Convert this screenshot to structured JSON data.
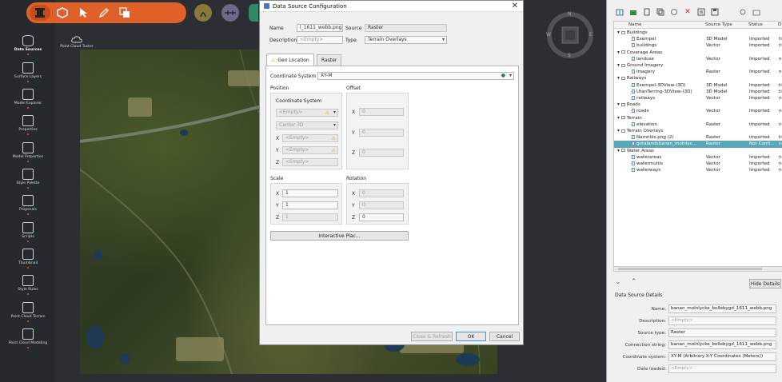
{
  "rail": [
    {
      "label": "Data Sources",
      "icon": "database-icon",
      "active": true
    },
    {
      "label": "Surface Layers",
      "icon": "layers-icon"
    },
    {
      "label": "Model Explorer",
      "icon": "model-explorer-icon"
    },
    {
      "label": "Properties",
      "icon": "properties-icon"
    },
    {
      "label": "Model Properties",
      "icon": "model-properties-icon"
    },
    {
      "label": "Style Palette",
      "icon": "style-palette-icon"
    },
    {
      "label": "Proposals",
      "icon": "proposals-icon"
    },
    {
      "label": "Scripts",
      "icon": "scripts-icon"
    },
    {
      "label": "Thumbnail",
      "icon": "thumbnail-icon"
    },
    {
      "label": "Style Rules",
      "icon": "style-rules-icon"
    },
    {
      "label": "Point Cloud Terrain",
      "icon": "point-cloud-terrain-icon"
    },
    {
      "label": "Point Cloud Modeling",
      "icon": "point-cloud-modeling-icon"
    }
  ],
  "map_uploader_label": "Point Cloud Tuster",
  "compass": {
    "n": "N",
    "s": "S",
    "e": "E",
    "w": "W"
  },
  "dialog": {
    "title": "Data Source Configuration",
    "name_label": "Name",
    "name_value": "l_1611_webb.png",
    "source_label": "Source",
    "source_value": "Raster",
    "description_label": "Description",
    "description_value": "<Empty>",
    "type_label": "Type",
    "type_value": "Terrain Overlays",
    "tabs": [
      "Geo Location",
      "Raster"
    ],
    "coord_system_label": "Coordinate System",
    "coord_system_value": "XY-M",
    "position_label": "Position",
    "offset_label": "Offset",
    "pos_coord_system_label": "Coordinate System",
    "pos_coord_value": "<Empty>",
    "pos_center_value": "Center 3D",
    "pos_x_value": "<Empty>",
    "pos_y_value": "<Empty>",
    "pos_z_value": "<Empty>",
    "offset_x": "0",
    "offset_y": "0",
    "offset_z": "0",
    "scale_label": "Scale",
    "scale_x": "1",
    "scale_y": "1",
    "scale_z": "1",
    "rotation_label": "Rotation",
    "rotation_x": "0",
    "rotation_y": "0",
    "rotation_z": "0",
    "x": "X",
    "y": "Y",
    "z": "Z",
    "interactive_button": "Interactive Plac...",
    "close_refresh": "Close & Refresh",
    "ok": "OK",
    "cancel": "Cancel"
  },
  "tree": {
    "columns": [
      "Name",
      "Source Type",
      "Status",
      "D"
    ],
    "rows": [
      {
        "indent": 0,
        "folder": true,
        "name": "Buildings",
        "type": "",
        "status": "",
        "d": ""
      },
      {
        "indent": 1,
        "name": "Exempel",
        "type": "3D Model",
        "status": "Imported",
        "d": "ti"
      },
      {
        "indent": 1,
        "name": "buildings",
        "type": "Vector",
        "status": "Imported",
        "d": "n"
      },
      {
        "indent": 0,
        "folder": true,
        "name": "Coverage Areas",
        "type": "",
        "status": "",
        "d": ""
      },
      {
        "indent": 1,
        "name": "landuse",
        "type": "Vector",
        "status": "Imported",
        "d": "n"
      },
      {
        "indent": 0,
        "folder": true,
        "name": "Ground Imagery",
        "type": "",
        "status": "",
        "d": ""
      },
      {
        "indent": 1,
        "name": "imagery",
        "type": "Raster",
        "status": "Imported",
        "d": "n"
      },
      {
        "indent": 0,
        "folder": true,
        "name": "Railways",
        "type": "",
        "status": "",
        "d": ""
      },
      {
        "indent": 1,
        "name": "Exempel-3DView-(3D)",
        "type": "3D Model",
        "status": "Imported",
        "d": "ti"
      },
      {
        "indent": 1,
        "name": "UtanTerring-3DView-(3D)",
        "type": "3D Model",
        "status": "Imported",
        "d": "ti"
      },
      {
        "indent": 1,
        "name": "railways",
        "type": "Vector",
        "status": "Imported",
        "d": "n"
      },
      {
        "indent": 0,
        "folder": true,
        "name": "Roads",
        "type": "",
        "status": "",
        "d": ""
      },
      {
        "indent": 1,
        "name": "roads",
        "type": "Vector",
        "status": "Imported",
        "d": "n"
      },
      {
        "indent": 0,
        "folder": true,
        "name": "Terrain",
        "type": "",
        "status": "",
        "d": ""
      },
      {
        "indent": 1,
        "name": "elevation",
        "type": "Raster",
        "status": "Imported",
        "d": "n"
      },
      {
        "indent": 0,
        "folder": true,
        "name": "Terrain Overlays",
        "type": "",
        "status": "",
        "d": ""
      },
      {
        "indent": 1,
        "name": "Namnlös.png (2)",
        "type": "Raster",
        "status": "Imported",
        "d": "ti"
      },
      {
        "indent": 1,
        "name": "gotalandsbanan_molnlyc...",
        "type": "Raster",
        "status": "Not Confi...",
        "d": "n",
        "selected": true
      },
      {
        "indent": 0,
        "folder": true,
        "name": "Water Areas",
        "type": "",
        "status": "",
        "d": ""
      },
      {
        "indent": 1,
        "name": "waterareas",
        "type": "Vector",
        "status": "Imported",
        "d": "n"
      },
      {
        "indent": 1,
        "name": "watermultis",
        "type": "Vector",
        "status": "Imported",
        "d": "n"
      },
      {
        "indent": 1,
        "name": "waterways",
        "type": "Vector",
        "status": "Imported",
        "d": "n"
      }
    ]
  },
  "hide_details": "Hide Details",
  "details_title": "Data Source Details",
  "details": [
    {
      "label": "Name:",
      "value": "banan_molnlycke_bollebygd_1611_webb.png",
      "empty": false
    },
    {
      "label": "Description:",
      "value": "<Empty>",
      "empty": true
    },
    {
      "label": "Source type:",
      "value": "Raster",
      "empty": false
    },
    {
      "label": "Connection string:",
      "value": "banan_molnlycke_bollebygd_1611_webb.png",
      "empty": false
    },
    {
      "label": "Coordinate system:",
      "value": "XY-M (Arbitrary X-Y Coordinates (Meters))",
      "empty": false
    },
    {
      "label": "Date loaded:",
      "value": "<Empty>",
      "empty": true
    }
  ],
  "colors": {
    "accent": "#e0602a",
    "selection": "#5aa7b7"
  }
}
